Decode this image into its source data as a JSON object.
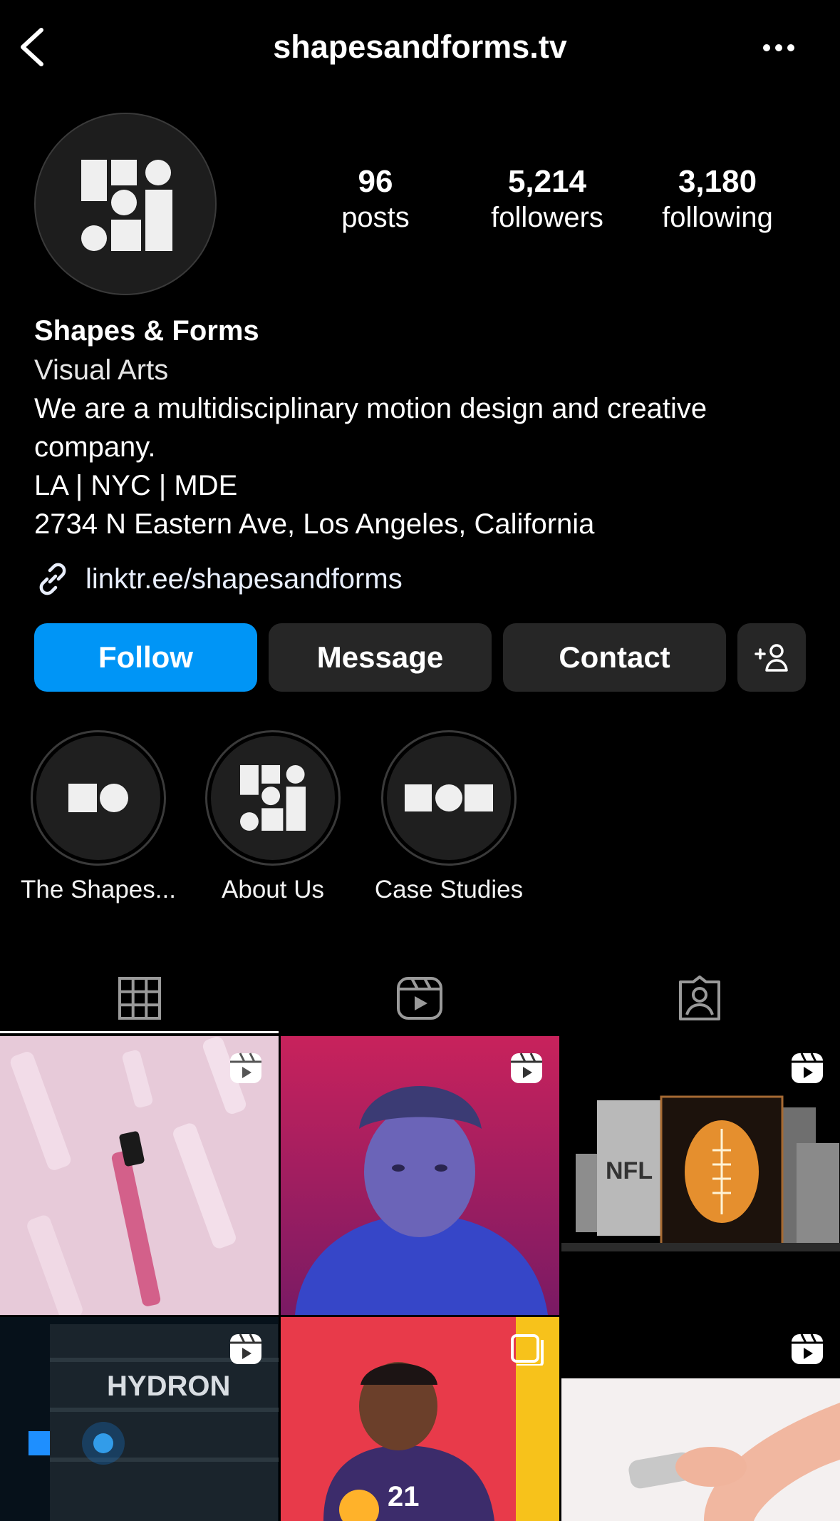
{
  "header": {
    "username": "shapesandforms.tv"
  },
  "profile": {
    "stats": [
      {
        "value": "96",
        "label": "posts"
      },
      {
        "value": "5,214",
        "label": "followers"
      },
      {
        "value": "3,180",
        "label": "following"
      }
    ],
    "name": "Shapes & Forms",
    "category": "Visual Arts",
    "bio_line1": "We are a multidisciplinary motion design and creative",
    "bio_line2": "company.",
    "cities": "LA | NYC | MDE",
    "address": "2734 N Eastern Ave, Los Angeles, California",
    "link": "linktr.ee/shapesandforms"
  },
  "actions": {
    "follow": "Follow",
    "message": "Message",
    "contact": "Contact"
  },
  "highlights": [
    {
      "label": "The Shapes..."
    },
    {
      "label": "About Us"
    },
    {
      "label": "Case Studies"
    }
  ],
  "tabs": [
    "grid-icon",
    "reels-icon",
    "tagged-icon"
  ],
  "grid_overlay_text": {
    "hydron": "HYDRON",
    "jersey_number": "21",
    "nfl": "NFL"
  },
  "colors": {
    "accent": "#0095f6",
    "button": "#262626",
    "background": "#000000"
  }
}
